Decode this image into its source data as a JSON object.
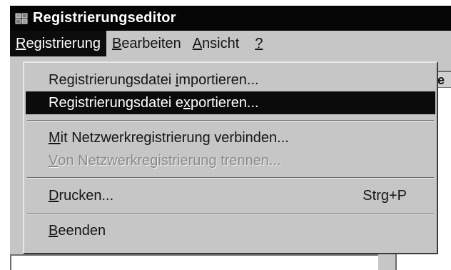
{
  "window": {
    "title": "Registrierungseditor",
    "title_icon": "registry-editor-icon"
  },
  "menubar": {
    "items": [
      {
        "mnemonic": "R",
        "rest": "egistrierung"
      },
      {
        "mnemonic": "B",
        "rest": "earbeiten"
      },
      {
        "mnemonic": "A",
        "rest": "nsicht"
      },
      {
        "mnemonic": "?",
        "rest": ""
      }
    ]
  },
  "dropdown": {
    "items": [
      {
        "pre": "Registrierungsdatei ",
        "mnemonic": "i",
        "post": "mportieren..."
      },
      {
        "pre": "Registrierungsdatei e",
        "mnemonic": "x",
        "post": "portieren..."
      },
      {
        "pre": "",
        "mnemonic": "M",
        "post": "it Netzwerkregistrierung verbinden..."
      },
      {
        "pre": "",
        "mnemonic": "V",
        "post": "on Netzwerkregistrierung trennen..."
      },
      {
        "pre": "",
        "mnemonic": "D",
        "post": "rucken...",
        "shortcut": "Strg+P"
      },
      {
        "pre": "",
        "mnemonic": "B",
        "post": "eenden"
      }
    ]
  },
  "right_pane": {
    "header_fragment": "ne"
  },
  "colors": {
    "title_bar": "#050505",
    "menu_background": "#c6c6c6",
    "highlight": "#0b0b0b",
    "disabled_text": "#8a8a8a"
  }
}
